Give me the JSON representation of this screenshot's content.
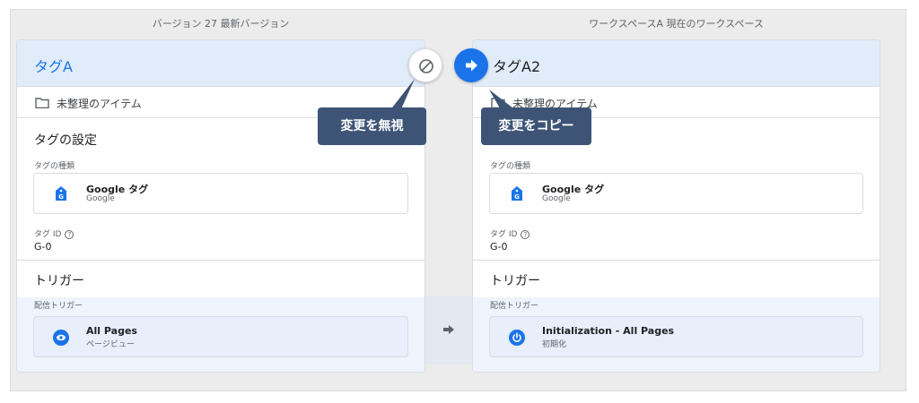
{
  "headers": {
    "left": "バージョン 27  最新バージョン",
    "right": "ワークスペースA  現在のワークスペース"
  },
  "left_panel": {
    "tag_name": "タグA",
    "folder": "未整理のアイテム",
    "tag_settings_title": "タグの設定",
    "tag_type_label": "タグの種類",
    "tag_type_name": "Google タグ",
    "tag_type_sub": "Google",
    "tag_id_label": "タグ ID",
    "tag_id_value": "G-0",
    "triggers_title": "トリガー",
    "firing_label": "配信トリガー",
    "trigger_name": "All Pages",
    "trigger_sub": "ページビュー"
  },
  "right_panel": {
    "tag_name": "タグA2",
    "folder": "未整理のアイテム",
    "tag_type_label": "タグの種類",
    "tag_type_name": "Google タグ",
    "tag_type_sub": "Google",
    "tag_id_label": "タグ ID",
    "tag_id_value": "G-0",
    "triggers_title": "トリガー",
    "firing_label": "配信トリガー",
    "trigger_name": "Initialization - All Pages",
    "trigger_sub": "初期化"
  },
  "buttons": {
    "ignore_icon": "block-icon",
    "copy_icon": "arrow-right-icon"
  },
  "tooltips": {
    "ignore": "変更を無視",
    "copy": "変更をコピー"
  },
  "colors": {
    "accent": "#1a73e8",
    "tooltip": "#3d5476",
    "title_band": "#e1ecfa"
  }
}
